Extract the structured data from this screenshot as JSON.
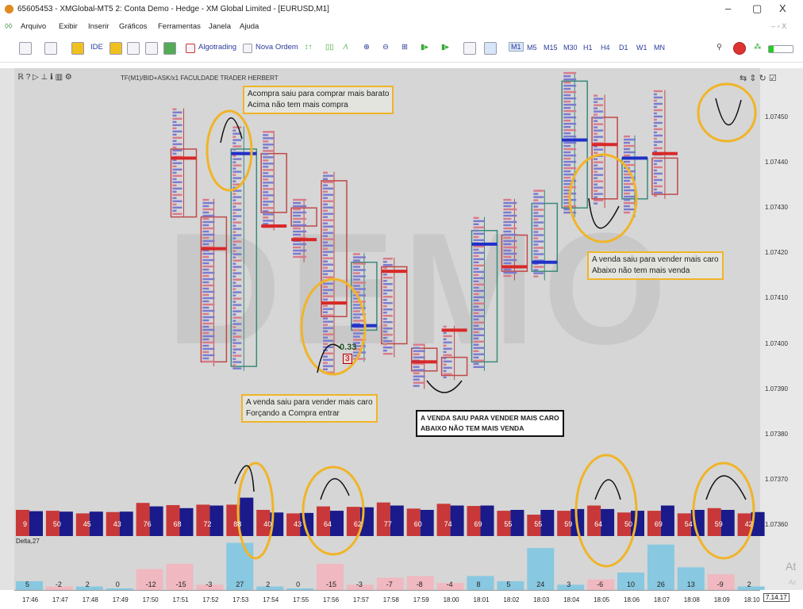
{
  "window": {
    "title": "65605453 - XMGlobal-MT5 2: Conta Demo - Hedge - XM Global Limited - [EURUSD,M1]",
    "min_glyph": "–",
    "max_glyph": "▢",
    "close_glyph": "X",
    "mdi_glyph": "– ▫ X"
  },
  "menu": [
    "Arquivo",
    "Exibir",
    "Inserir",
    "Gráficos",
    "Ferramentas",
    "Janela",
    "Ajuda"
  ],
  "toolbar": {
    "ide_label": "IDE",
    "algotrading_label": "Algotrading",
    "nova_ordem_label": "Nova Ordem",
    "timeframes": [
      "M1",
      "M5",
      "M15",
      "M30",
      "H1",
      "H4",
      "D1",
      "W1",
      "MN"
    ],
    "active_timeframe": "M1"
  },
  "chart_header": {
    "tools": "ℝ ? ▷ ⊥ ℹ ▥ ⚙",
    "title": "TF(M1)/BID+ASK/x1  FACULDADE TRADER HERBERT",
    "right_tools": "⇆ ⇕ ↻ ☑"
  },
  "watermark": "DEMO",
  "annotations": {
    "top_note": [
      "Acompra saiu para comprar mais barato",
      "Acima não tem mais compra"
    ],
    "right_note": [
      "A venda saiu para vender mais caro",
      "Abaixo não tem mais venda"
    ],
    "bottom_note": [
      "A venda saiu para vender mais caro",
      "Forçando a Compra entrar"
    ],
    "dark_note": [
      "A VENDA SAIU PARA VENDER MAIS CARO",
      "ABAIXO NÃO TEM MAIS VENDA"
    ]
  },
  "candle_label_value": "0.33",
  "candle_label_count": "3",
  "delta_label": "Delta,27",
  "corner_box": "7.14.17",
  "windows_activate": "At",
  "windows_activate_sub": "Ac",
  "colors": {
    "bull": "#3a8a7a",
    "bear": "#c04848",
    "ask_vol": "#c83838",
    "bid_vol": "#1a1a8a",
    "delta_pos": "#88c8e0",
    "delta_neg": "#f0b8c0",
    "highlight": "#f0b428"
  },
  "chart_data": [
    {
      "type": "candlestick-footprint",
      "title": "TF(M1)/BID+ASK/x1  FACULDADE TRADER HERBERT",
      "ylim": [
        1.07355,
        1.0746
      ],
      "y_ticks": [
        "1.07450",
        "1.07440",
        "1.07430",
        "1.07420",
        "1.07410",
        "1.07400",
        "1.07390",
        "1.07380",
        "1.07370",
        "1.07360"
      ],
      "x": [
        "17:46",
        "17:47",
        "17:48",
        "17:49",
        "17:50",
        "17:51",
        "17:52",
        "17:53",
        "17:54",
        "17:55",
        "17:56",
        "17:57",
        "17:58",
        "17:59",
        "18:00",
        "18:01",
        "18:02",
        "18:03",
        "18:04",
        "18:05",
        "18:06",
        "18:07",
        "18:08",
        "18:09",
        "18:10"
      ],
      "candles": [
        {
          "time": "17:51",
          "open": 1.07443,
          "close": 1.07428,
          "high": 1.07452,
          "low": 1.07428,
          "poc": 1.07441
        },
        {
          "time": "17:52",
          "open": 1.07428,
          "close": 1.07396,
          "high": 1.07432,
          "low": 1.07395,
          "poc": 1.07421
        },
        {
          "time": "17:53",
          "open": 1.07395,
          "close": 1.07443,
          "high": 1.07448,
          "low": 1.07394,
          "poc": 1.07442
        },
        {
          "time": "17:54",
          "open": 1.07442,
          "close": 1.07429,
          "high": 1.07447,
          "low": 1.07425,
          "poc": 1.07426
        },
        {
          "time": "17:55",
          "open": 1.0743,
          "close": 1.07426,
          "high": 1.07432,
          "low": 1.07418,
          "poc": 1.07423
        },
        {
          "time": "17:56",
          "open": 1.07436,
          "close": 1.07406,
          "high": 1.07438,
          "low": 1.07393,
          "poc": 1.07409
        },
        {
          "time": "17:57",
          "open": 1.07403,
          "close": 1.07418,
          "high": 1.0742,
          "low": 1.07396,
          "poc": 1.07404
        },
        {
          "time": "17:58",
          "open": 1.07417,
          "close": 1.074,
          "high": 1.07419,
          "low": 1.07397,
          "poc": 1.07416
        },
        {
          "time": "17:59",
          "open": 1.07399,
          "close": 1.07394,
          "high": 1.074,
          "low": 1.0739,
          "poc": 1.07396
        },
        {
          "time": "18:00",
          "open": 1.07397,
          "close": 1.07393,
          "high": 1.07404,
          "low": 1.07392,
          "poc": 1.07403
        },
        {
          "time": "18:01",
          "open": 1.07396,
          "close": 1.07425,
          "high": 1.07428,
          "low": 1.07394,
          "poc": 1.07422
        },
        {
          "time": "18:02",
          "open": 1.07424,
          "close": 1.07416,
          "high": 1.07432,
          "low": 1.07414,
          "poc": 1.07417
        },
        {
          "time": "18:03",
          "open": 1.07416,
          "close": 1.07431,
          "high": 1.07434,
          "low": 1.07414,
          "poc": 1.07418
        },
        {
          "time": "18:04",
          "open": 1.0743,
          "close": 1.07458,
          "high": 1.0746,
          "low": 1.07428,
          "poc": 1.07445
        },
        {
          "time": "18:05",
          "open": 1.0745,
          "close": 1.07432,
          "high": 1.07455,
          "low": 1.0743,
          "poc": 1.07444
        },
        {
          "time": "18:06",
          "open": 1.07432,
          "close": 1.07441,
          "high": 1.07446,
          "low": 1.07428,
          "poc": 1.07441
        },
        {
          "time": "18:07",
          "open": 1.07441,
          "close": 1.07433,
          "high": 1.07456,
          "low": 1.07432,
          "poc": 1.07442
        }
      ],
      "volume_bars": [
        {
          "label": "9",
          "ask": 60,
          "bid": 57
        },
        {
          "label": "50",
          "ask": 58,
          "bid": 56
        },
        {
          "label": "45",
          "ask": 52,
          "bid": 56
        },
        {
          "label": "43",
          "ask": 55,
          "bid": 56
        },
        {
          "label": "76",
          "ask": 76,
          "bid": 68
        },
        {
          "label": "68",
          "ask": 71,
          "bid": 64
        },
        {
          "label": "72",
          "ask": 72,
          "bid": 70
        },
        {
          "label": "88",
          "ask": 72,
          "bid": 88
        },
        {
          "label": "40",
          "ask": 60,
          "bid": 54
        },
        {
          "label": "43",
          "ask": 52,
          "bid": 53
        },
        {
          "label": "64",
          "ask": 68,
          "bid": 58
        },
        {
          "label": "62",
          "ask": 67,
          "bid": 66
        },
        {
          "label": "77",
          "ask": 77,
          "bid": 70
        },
        {
          "label": "60",
          "ask": 63,
          "bid": 60
        },
        {
          "label": "74",
          "ask": 74,
          "bid": 70
        },
        {
          "label": "69",
          "ask": 69,
          "bid": 70
        },
        {
          "label": "55",
          "ask": 58,
          "bid": 60
        },
        {
          "label": "55",
          "ask": 49,
          "bid": 60
        },
        {
          "label": "59",
          "ask": 58,
          "bid": 62
        },
        {
          "label": "64",
          "ask": 70,
          "bid": 62
        },
        {
          "label": "50",
          "ask": 54,
          "bid": 58
        },
        {
          "label": "69",
          "ask": 58,
          "bid": 70
        },
        {
          "label": "54",
          "ask": 52,
          "bid": 60
        },
        {
          "label": "59",
          "ask": 64,
          "bid": 60
        },
        {
          "label": "42",
          "ask": 52,
          "bid": 55
        }
      ],
      "delta": [
        {
          "label": "5",
          "value": 5
        },
        {
          "label": "-2",
          "value": -2
        },
        {
          "label": "2",
          "value": 2
        },
        {
          "label": "0",
          "value": 0
        },
        {
          "label": "-12",
          "value": -12
        },
        {
          "label": "-15",
          "value": -15
        },
        {
          "label": "-3",
          "value": -3
        },
        {
          "label": "27",
          "value": 27
        },
        {
          "label": "2",
          "value": 2
        },
        {
          "label": "0",
          "value": 0
        },
        {
          "label": "-15",
          "value": -15
        },
        {
          "label": "-3",
          "value": -3
        },
        {
          "label": "-7",
          "value": -7
        },
        {
          "label": "-8",
          "value": -8
        },
        {
          "label": "-4",
          "value": -4
        },
        {
          "label": "8",
          "value": 8
        },
        {
          "label": "5",
          "value": 5
        },
        {
          "label": "24",
          "value": 24
        },
        {
          "label": "3",
          "value": 3
        },
        {
          "label": "-6",
          "value": -6
        },
        {
          "label": "10",
          "value": 10
        },
        {
          "label": "26",
          "value": 26
        },
        {
          "label": "13",
          "value": 13
        },
        {
          "label": "-9",
          "value": -9
        },
        {
          "label": "2",
          "value": 2
        }
      ]
    }
  ]
}
